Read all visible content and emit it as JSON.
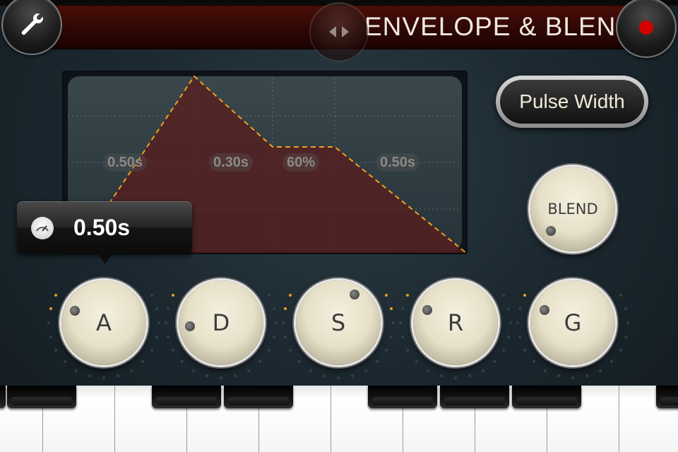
{
  "header": {
    "title": "ENVELOPE & BLEND",
    "settings_icon": "wrench-icon",
    "swap_icon": "left-right-arrows-icon",
    "record_icon": "record-dot-icon",
    "record_color": "#d40000"
  },
  "envelope": {
    "segments": [
      "0.50s",
      "0.30s",
      "60%",
      "0.50s"
    ],
    "line_color": "#f0a020",
    "fill_color": "#5a1c1c"
  },
  "pulse_width_button": "Pulse Width",
  "blend_knob": "BLEND",
  "tooltip": {
    "icon": "gauge-icon",
    "value": "0.50s"
  },
  "knobs": [
    "A",
    "D",
    "S",
    "R",
    "G"
  ],
  "accent_tick_color": "#e8a018"
}
